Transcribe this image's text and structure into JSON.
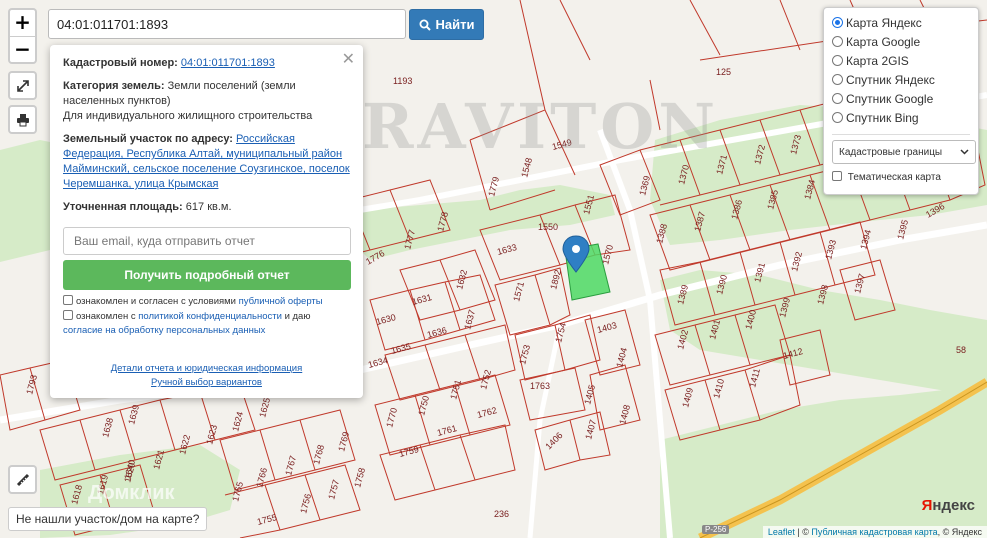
{
  "search": {
    "value": "04:01:011701:1893",
    "button_label": "Найти"
  },
  "zoom": {
    "in_label": "+",
    "out_label": "−"
  },
  "info": {
    "cadastral_label": "Кадастровый номер:",
    "cadastral_value": "04:01:011701:1893",
    "category_label": "Категория земель:",
    "category_value": "Земли поселений (земли населенных пунктов)",
    "usage": "Для индивидуального жилищного строительства",
    "address_label": "Земельный участок по адресу:",
    "address_value": "Российская Федерация, Республика Алтай, муниципальный район Майминский, сельское поселение Соузгинское, поселок Черемшанка, улица Крымская",
    "area_label": "Уточненная площадь:",
    "area_value": "617 кв.м.",
    "email_placeholder": "Ваш email, куда отправить отчет",
    "report_button": "Получить подробный отчет",
    "agree1_text": "ознакомлен и согласен с условиями",
    "agree1_link": "публичной оферты",
    "agree2_text": "ознакомлен с",
    "agree2_link1": "политикой конфиденциальности",
    "agree2_mid": "и даю",
    "agree2_link2": "согласие на обработку персональных данных",
    "details_link": "Детали отчета и юридическая информация",
    "manual_link": "Ручной выбор вариантов"
  },
  "layers": {
    "options": [
      "Карта Яндекс",
      "Карта Google",
      "Карта 2GIS",
      "Спутник Яндекс",
      "Спутник Google",
      "Спутник Bing"
    ],
    "selected_index": 0,
    "select_value": "Кадастровые границы",
    "thematic_label": "Тематическая карта"
  },
  "map": {
    "watermark": "GRAVITON",
    "watermark2": "Домклик",
    "road_badge": "Р-256",
    "yandex_logo_y": "Я",
    "yandex_logo_rest": "ндекс",
    "selected_parcel_color": "#4cd964",
    "parcel_line_color": "#c0392b",
    "labels": [
      "1193",
      "125",
      "1369",
      "1370",
      "1371",
      "1372",
      "1373",
      "1374",
      "1384",
      "1385",
      "1386",
      "1387",
      "1388",
      "1389",
      "1390",
      "1391",
      "1392",
      "1393",
      "1394",
      "1395",
      "1396",
      "1397",
      "1398",
      "1399",
      "1400",
      "1401",
      "1402",
      "1403",
      "1404",
      "1405",
      "1406",
      "1407",
      "1408",
      "1409",
      "1410",
      "1411",
      "1412",
      "1548",
      "1549",
      "1550",
      "1551",
      "1570",
      "1571",
      "1892",
      "1633",
      "1779",
      "1778",
      "1777",
      "1776",
      "1632",
      "1631",
      "1630",
      "1637",
      "1636",
      "1635",
      "1634",
      "1754",
      "1753",
      "1752",
      "1751",
      "1750",
      "1763",
      "1762",
      "1761",
      "1770",
      "1759",
      "1769",
      "1768",
      "1767",
      "1766",
      "1765",
      "1758",
      "1757",
      "1756",
      "1755",
      "1793",
      "1638",
      "1639",
      "1640",
      "1621",
      "1622",
      "1623",
      "1624",
      "1625",
      "1618",
      "1619",
      "1620",
      "236",
      "58"
    ]
  },
  "not_found_button": "Не нашли участок/дом на карте?",
  "attribution": {
    "leaflet": "Leaflet",
    "sep": "|",
    "copy": "©",
    "pkk": "Публичная кадастровая карта",
    "tail": ", © Яндекс"
  }
}
